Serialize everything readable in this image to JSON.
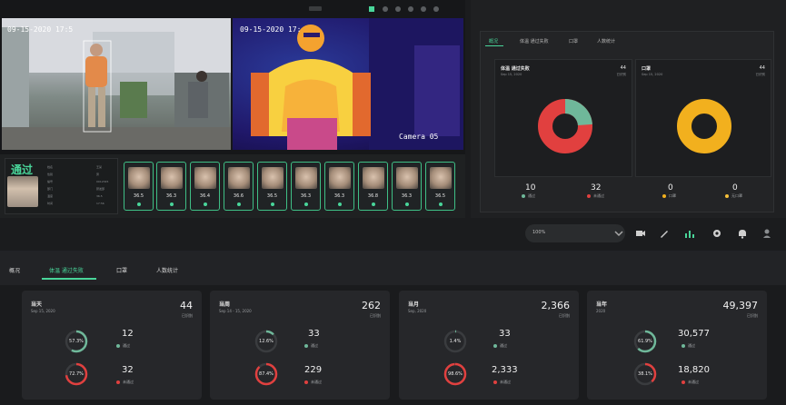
{
  "cameras": {
    "left_timestamp": "09-15-2020 17:5",
    "right_timestamp": "09-15-2020 17:",
    "right_label": "Camera 05"
  },
  "pass_panel": {
    "status": "通过",
    "info_rows": [
      {
        "key": "姓名",
        "value": "王某"
      },
      {
        "key": "性别",
        "value": "男"
      },
      {
        "key": "编号",
        "value": "0012345"
      },
      {
        "key": "部门",
        "value": "研发部"
      },
      {
        "key": "温度",
        "value": "36.5"
      },
      {
        "key": "时间",
        "value": "17:56"
      }
    ]
  },
  "face_cards": [
    {
      "temp": "36.5"
    },
    {
      "temp": "36.3"
    },
    {
      "temp": "36.4"
    },
    {
      "temp": "36.6"
    },
    {
      "temp": "36.5"
    },
    {
      "temp": "36.3"
    },
    {
      "temp": "36.3"
    },
    {
      "temp": "36.8"
    },
    {
      "temp": "36.3"
    },
    {
      "temp": "36.5"
    }
  ],
  "right_panel": {
    "tabs": [
      "概况",
      "体温 通过失败",
      "口罩",
      "人数统计"
    ],
    "active_tab": 0,
    "donut_left": {
      "title": "体温 通过失败",
      "date": "Sep 15, 2020",
      "count": "44",
      "count_label": "已识别",
      "stat_a_value": "10",
      "stat_a_label": "通过",
      "stat_b_value": "32",
      "stat_b_label": "未通过",
      "pct_green": 0.238
    },
    "donut_right": {
      "title": "口罩",
      "date": "Sep 15, 2020",
      "count": "44",
      "count_label": "已识别",
      "stat_a_value": "0",
      "stat_a_label": "口罩",
      "stat_b_value": "0",
      "stat_b_label": "无口罩"
    },
    "colors": {
      "green": "#6fb89a",
      "red": "#e1403f",
      "yellow": "#f2b01e",
      "orange": "#f6c13a"
    }
  },
  "control_bar": {
    "zoom_value": "100%",
    "icons": [
      "camera-icon",
      "edit-icon",
      "chart-icon",
      "settings-icon",
      "bell-icon",
      "user-icon"
    ]
  },
  "bottom_tabs": {
    "items": [
      "概况",
      "体温 通过失败",
      "口罩",
      "人数统计"
    ],
    "active": 1
  },
  "cards": [
    {
      "title": "当天",
      "date": "Sep 15, 2020",
      "total": "44",
      "total_label": "已识别",
      "r1_pct": "57.3%",
      "r1_value": "12",
      "r1_label": "通过",
      "r1_frac": 0.573,
      "r2_pct": "72.7%",
      "r2_value": "32",
      "r2_label": "未通过",
      "r2_frac": 0.727
    },
    {
      "title": "当周",
      "date": "Sep 14 - 15, 2020",
      "total": "262",
      "total_label": "已识别",
      "r1_pct": "12.6%",
      "r1_value": "33",
      "r1_label": "通过",
      "r1_frac": 0.126,
      "r2_pct": "87.4%",
      "r2_value": "229",
      "r2_label": "未通过",
      "r2_frac": 0.874
    },
    {
      "title": "当月",
      "date": "Sep, 2020",
      "total": "2,366",
      "total_label": "已识别",
      "r1_pct": "1.4%",
      "r1_value": "33",
      "r1_label": "通过",
      "r1_frac": 0.014,
      "r2_pct": "98.6%",
      "r2_value": "2,333",
      "r2_label": "未通过",
      "r2_frac": 0.986
    },
    {
      "title": "当年",
      "date": "2020",
      "total": "49,397",
      "total_label": "已识别",
      "r1_pct": "61.9%",
      "r1_value": "30,577",
      "r1_label": "通过",
      "r1_frac": 0.619,
      "r2_pct": "38.1%",
      "r2_value": "18,820",
      "r2_label": "未通过",
      "r2_frac": 0.381
    }
  ]
}
